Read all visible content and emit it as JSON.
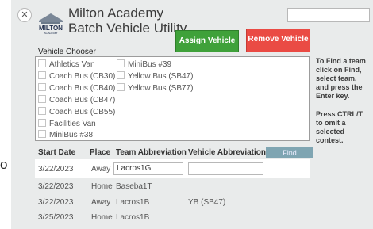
{
  "header": {
    "line1": "Milton Academy",
    "line2": "Batch Vehicle Utility",
    "logo_text": "MILTON",
    "logo_sub": "ACADEMY"
  },
  "buttons": {
    "assign": "Assign Vehicle",
    "remove": "Remove Vehicle",
    "find": "Find"
  },
  "chooser": {
    "label": "Vehicle Chooser",
    "col1": [
      "Athletics Van",
      "Coach Bus (CB30)",
      "Coach Bus (CB40)",
      "Coach Bus (CB47)",
      "Coach Bus (CB55)",
      "Facilities Van",
      "MiniBus #38"
    ],
    "col2": [
      "MiniBus #39",
      "Yellow Bus (SB47)",
      "Yellow Bus (SB77)"
    ]
  },
  "help": {
    "p1": "To Find a team click on Find, select team, and press the Enter key.",
    "p2": "Press CTRL/T to omit a selected contest."
  },
  "table": {
    "headers": [
      "Start Date",
      "Place",
      "Team Abbreviation",
      "Vehicle Abbreviation"
    ],
    "rows": [
      {
        "date": "3/22/2023",
        "place": "Away",
        "team": "Lacros1G",
        "vehicle": ""
      },
      {
        "date": "3/22/2023",
        "place": "Home",
        "team": "Baseba1T",
        "vehicle": ""
      },
      {
        "date": "3/22/2023",
        "place": "Away",
        "team": "Lacros1B",
        "vehicle": "YB (SB47)"
      },
      {
        "date": "3/25/2023",
        "place": "Home",
        "team": "Lacros1B",
        "vehicle": ""
      }
    ]
  },
  "edge_char": "o",
  "colors": {
    "assign": "#3fa13a",
    "remove": "#ea4b44",
    "find": "#7fa5b2",
    "panel": "#e9ebeb"
  }
}
